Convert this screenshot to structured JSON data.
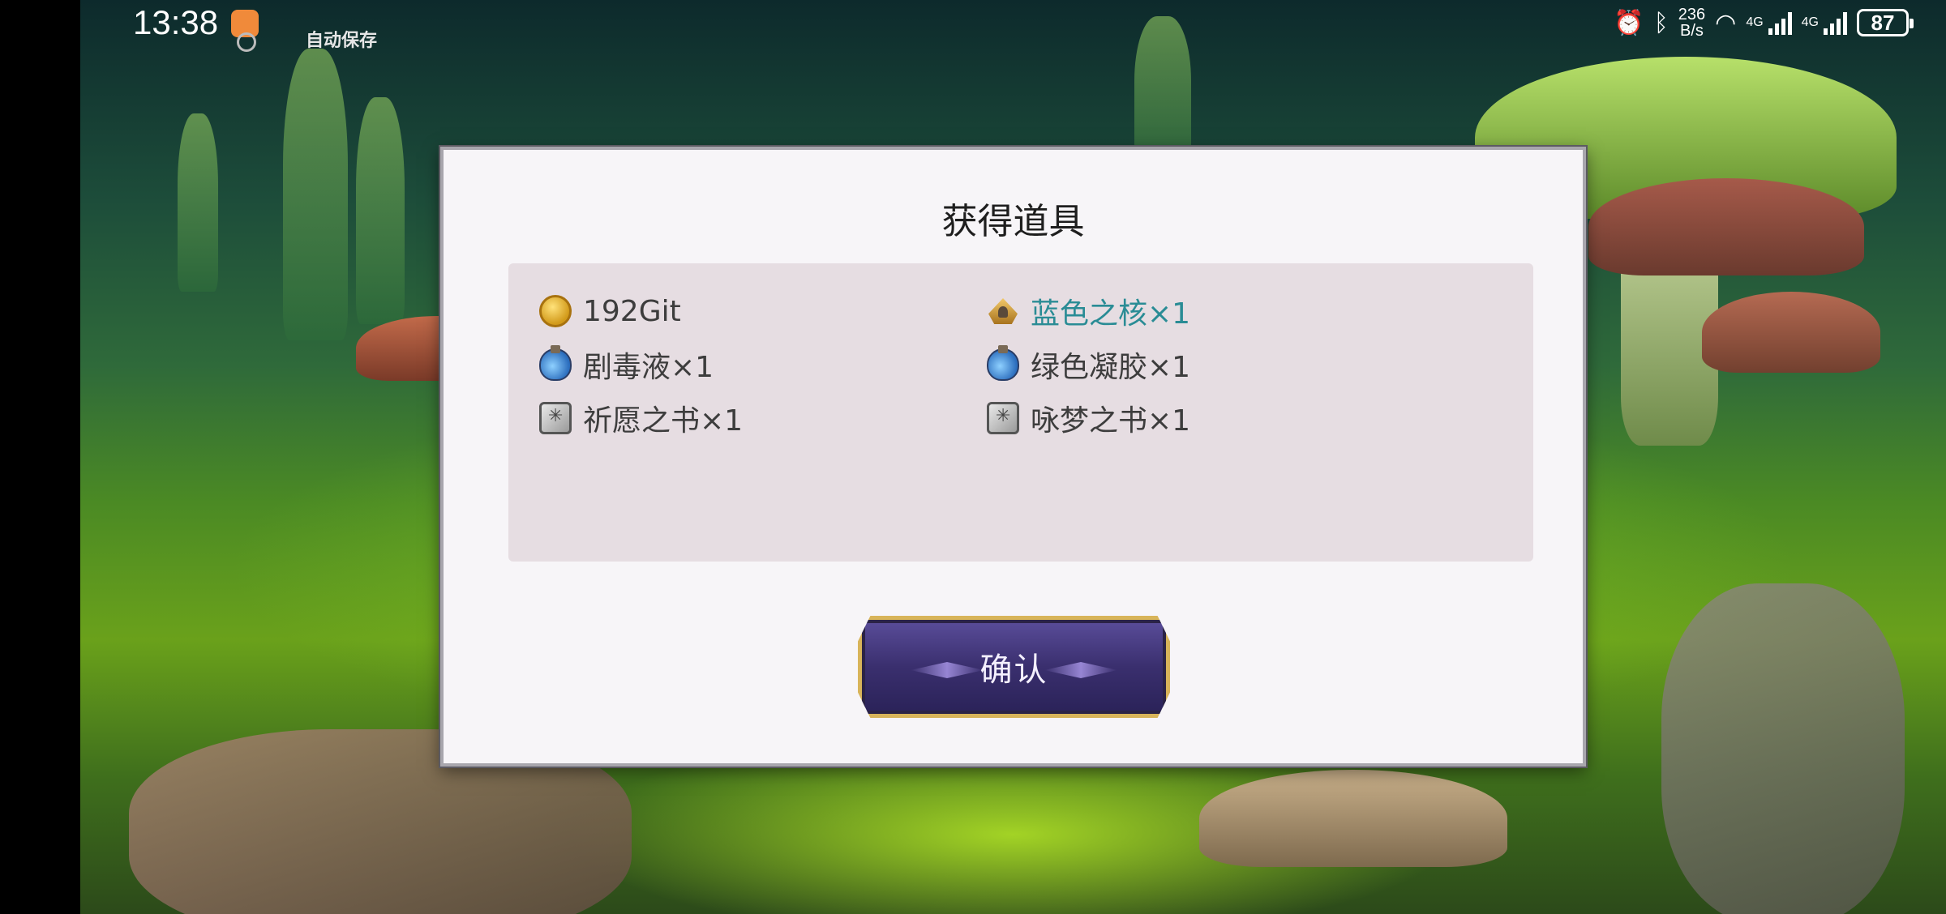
{
  "status_bar": {
    "time": "13:38",
    "autosave_label": "自动保存",
    "net_speed_value": "236",
    "net_speed_unit": "B/s",
    "network_1": "4G",
    "network_2": "4G",
    "battery": "87"
  },
  "dialog": {
    "title": "获得道具",
    "items": [
      {
        "label": "192Git",
        "icon": "gold-coin-icon",
        "rare": false
      },
      {
        "label": "蓝色之核×1",
        "icon": "blue-core-icon",
        "rare": true
      },
      {
        "label": "剧毒液×1",
        "icon": "potion-icon",
        "rare": false
      },
      {
        "label": "绿色凝胶×1",
        "icon": "potion-icon",
        "rare": false
      },
      {
        "label": "祈愿之书×1",
        "icon": "book-icon",
        "rare": false
      },
      {
        "label": "咏梦之书×1",
        "icon": "book-icon",
        "rare": false
      }
    ],
    "confirm_label": "确认"
  },
  "colors": {
    "rare_item_text": "#2a8c95",
    "normal_item_text": "#3d3d3d",
    "button_border": "#d8b45a",
    "button_fill": "#3a2f6e"
  }
}
